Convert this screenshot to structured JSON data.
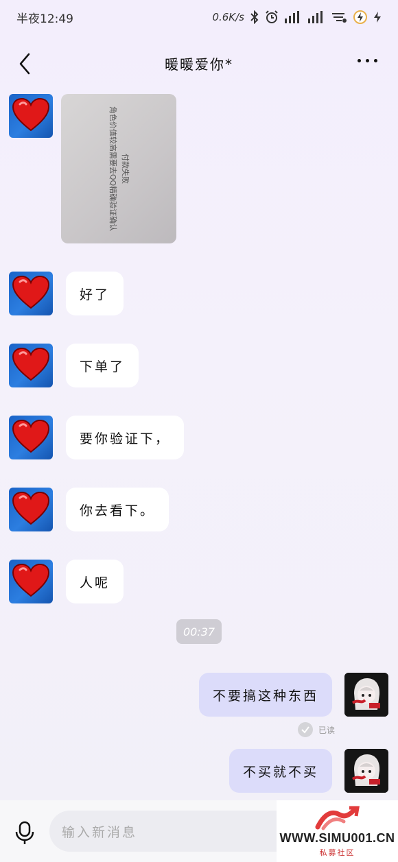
{
  "status_bar": {
    "time": "半夜12:49",
    "net_speed": "0.6K/s"
  },
  "header": {
    "title": "暖暖爱你*"
  },
  "messages": {
    "image_msg": {
      "line1": "付款失败",
      "line2": "角色价值较高需要去QQ精确验证确认"
    },
    "incoming": [
      "好了",
      "下单了",
      "要你验证下，",
      "你去看下。",
      "人呢"
    ],
    "timestamp": "00:37",
    "outgoing": [
      "不要搞这种东西",
      "不买就不买"
    ],
    "read_label": "已读"
  },
  "input": {
    "placeholder": "输入新消息"
  },
  "watermark": {
    "url": "WWW.SIMU001.CN",
    "sub": "私募社区"
  },
  "colors": {
    "incoming_bubble": "#ffffff",
    "outgoing_bubble": "#dcdcfa",
    "avatar_heart_bg": "#1a63c7",
    "heart": "#e01818"
  }
}
